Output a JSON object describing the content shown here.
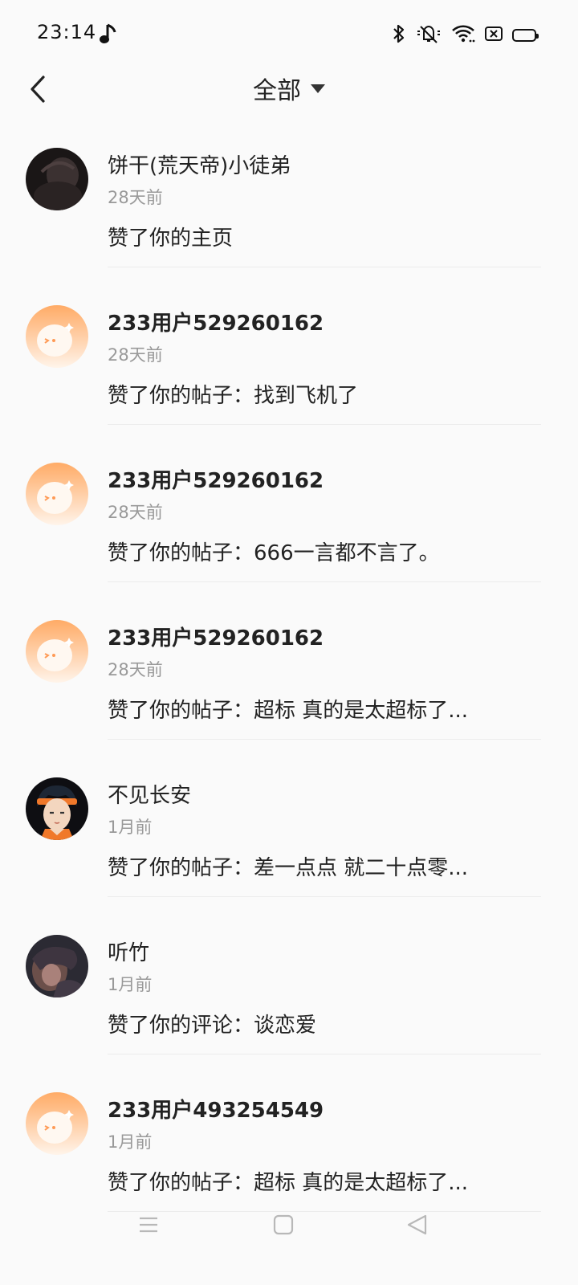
{
  "status_bar": {
    "time": "23:14",
    "icons": [
      "music-note-icon",
      "bluetooth-icon",
      "mute-icon",
      "wifi-icon",
      "sim-icon",
      "battery-icon"
    ],
    "battery_color": "#f4c21b"
  },
  "header": {
    "title": "全部",
    "back_icon": "chevron-left-icon",
    "dropdown_icon": "caret-down-icon"
  },
  "notifications": [
    {
      "name": "饼干(荒天帝)小徒弟",
      "bold": false,
      "avatar": "dark-photo",
      "time": "28天前",
      "message": "赞了你的主页"
    },
    {
      "name": "233用户529260162",
      "bold": true,
      "avatar": "default-orange",
      "time": "28天前",
      "message": "赞了你的帖子：找到飞机了"
    },
    {
      "name": "233用户529260162",
      "bold": true,
      "avatar": "default-orange",
      "time": "28天前",
      "message": "赞了你的帖子：666一言都不言了。"
    },
    {
      "name": "233用户529260162",
      "bold": true,
      "avatar": "default-orange",
      "time": "28天前",
      "message": "赞了你的帖子：超标 真的是太超标了..."
    },
    {
      "name": "不见长安",
      "bold": false,
      "avatar": "anime-boy",
      "time": "1月前",
      "message": "赞了你的帖子：差一点点 就二十点零..."
    },
    {
      "name": "听竹",
      "bold": false,
      "avatar": "dark-portrait",
      "time": "1月前",
      "message": "赞了你的评论：谈恋爱"
    },
    {
      "name": "233用户493254549",
      "bold": true,
      "avatar": "default-orange",
      "time": "1月前",
      "message": "赞了你的帖子：超标 真的是太超标了..."
    }
  ],
  "nav_bar": {
    "icons": [
      "menu-icon",
      "home-square-icon",
      "back-triangle-icon"
    ]
  },
  "colors": {
    "background": "#fafafa",
    "avatar_orange": "#ffab66",
    "secondary_text": "#999999"
  }
}
